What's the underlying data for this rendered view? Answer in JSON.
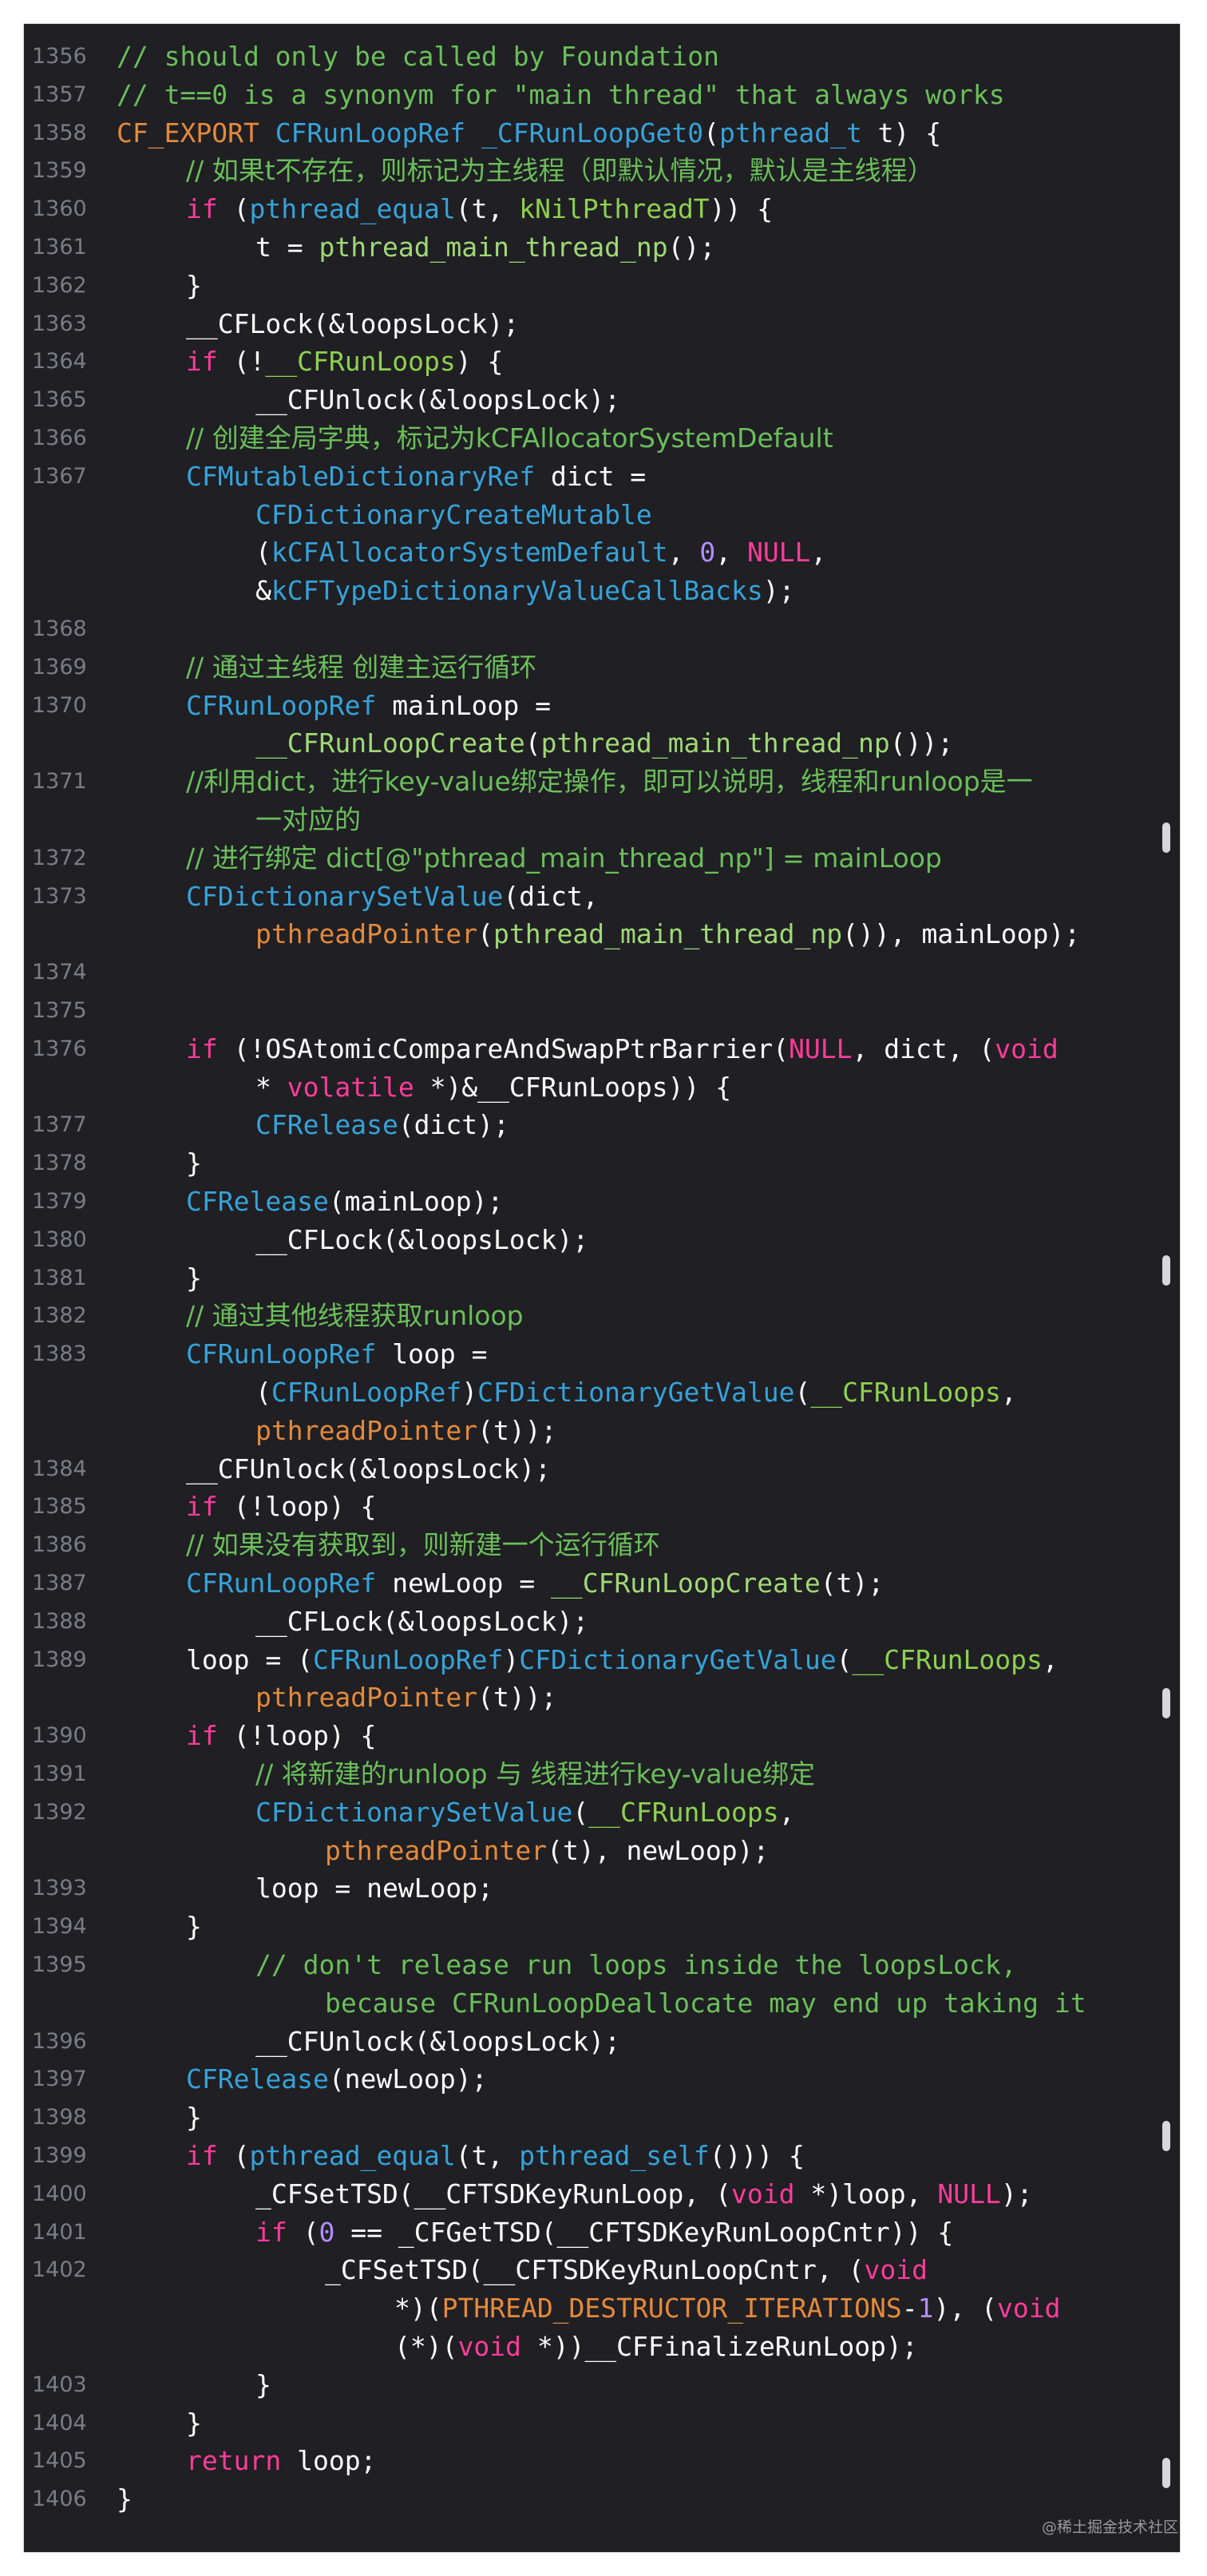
{
  "watermark": "@稀土掘金技术社区",
  "lines": [
    {
      "ln": "1356",
      "segs": [
        {
          "t": "// should only be called by Foundation",
          "c": "comment"
        }
      ]
    },
    {
      "ln": "1357",
      "segs": [
        {
          "t": "// t==0 is a synonym for \"main thread\" that always works",
          "c": "comment"
        }
      ]
    },
    {
      "ln": "1358",
      "segs": [
        {
          "t": "CF_EXPORT ",
          "c": "orange"
        },
        {
          "t": "CFRunLoopRef ",
          "c": "blue"
        },
        {
          "t": "_CFRunLoopGet0",
          "c": "blue"
        },
        {
          "t": "(",
          "c": "plain"
        },
        {
          "t": "pthread_t",
          "c": "blue"
        },
        {
          "t": " t) {",
          "c": "plain"
        }
      ]
    },
    {
      "ln": "1359",
      "ind": 1,
      "segs": [
        {
          "t": "// 如果t不存在，则标记为主线程（即默认情况，默认是主线程）",
          "c": "comment cjk"
        }
      ]
    },
    {
      "ln": "1360",
      "ind": 1,
      "segs": [
        {
          "t": "if",
          "c": "magenta"
        },
        {
          "t": " (",
          "c": "plain"
        },
        {
          "t": "pthread_equal",
          "c": "blue"
        },
        {
          "t": "(t, ",
          "c": "plain"
        },
        {
          "t": "kNilPthreadT",
          "c": "lgreen"
        },
        {
          "t": ")) {",
          "c": "plain"
        }
      ]
    },
    {
      "ln": "1361",
      "ind": 2,
      "segs": [
        {
          "t": "t = ",
          "c": "plain"
        },
        {
          "t": "pthread_main_thread_np",
          "c": "green"
        },
        {
          "t": "();",
          "c": "plain"
        }
      ]
    },
    {
      "ln": "1362",
      "ind": 1,
      "segs": [
        {
          "t": "}",
          "c": "plain"
        }
      ]
    },
    {
      "ln": "1363",
      "ind": 1,
      "segs": [
        {
          "t": "__CFLock(&loopsLock);",
          "c": "plain"
        }
      ]
    },
    {
      "ln": "1364",
      "ind": 1,
      "segs": [
        {
          "t": "if",
          "c": "magenta"
        },
        {
          "t": " (!",
          "c": "plain"
        },
        {
          "t": "__CFRunLoops",
          "c": "lgreen"
        },
        {
          "t": ") {",
          "c": "plain"
        }
      ]
    },
    {
      "ln": "1365",
      "ind": 2,
      "segs": [
        {
          "t": "__CFUnlock(&loopsLock);",
          "c": "plain"
        }
      ]
    },
    {
      "ln": "1366",
      "ind": 1,
      "segs": [
        {
          "t": "// 创建全局字典，标记为kCFAllocatorSystemDefault",
          "c": "comment cjk"
        }
      ]
    },
    {
      "ln": "1367",
      "ind": 1,
      "segs": [
        {
          "t": "CFMutableDictionaryRef",
          "c": "blue"
        },
        {
          "t": " dict =",
          "c": "plain"
        }
      ]
    },
    {
      "ln": "",
      "ind": 2,
      "segs": [
        {
          "t": "CFDictionaryCreateMutable",
          "c": "blue"
        }
      ]
    },
    {
      "ln": "",
      "ind": 2,
      "segs": [
        {
          "t": "(",
          "c": "plain"
        },
        {
          "t": "kCFAllocatorSystemDefault",
          "c": "blue"
        },
        {
          "t": ", ",
          "c": "plain"
        },
        {
          "t": "0",
          "c": "purple"
        },
        {
          "t": ", ",
          "c": "plain"
        },
        {
          "t": "NULL",
          "c": "magenta"
        },
        {
          "t": ",",
          "c": "plain"
        }
      ]
    },
    {
      "ln": "",
      "ind": 2,
      "segs": [
        {
          "t": "&",
          "c": "plain"
        },
        {
          "t": "kCFTypeDictionaryValueCallBacks",
          "c": "blue"
        },
        {
          "t": ");",
          "c": "plain"
        }
      ]
    },
    {
      "ln": "1368",
      "segs": []
    },
    {
      "ln": "1369",
      "ind": 1,
      "segs": [
        {
          "t": "// 通过主线程 创建主运行循环",
          "c": "comment cjk"
        }
      ]
    },
    {
      "ln": "1370",
      "ind": 1,
      "segs": [
        {
          "t": "CFRunLoopRef",
          "c": "blue"
        },
        {
          "t": " mainLoop =",
          "c": "plain"
        }
      ]
    },
    {
      "ln": "",
      "ind": 2,
      "segs": [
        {
          "t": "__CFRunLoopCreate",
          "c": "green"
        },
        {
          "t": "(",
          "c": "plain"
        },
        {
          "t": "pthread_main_thread_np",
          "c": "green"
        },
        {
          "t": "());",
          "c": "plain"
        }
      ]
    },
    {
      "ln": "1371",
      "ind": 1,
      "segs": [
        {
          "t": "//利用dict，进行key-value绑定操作，即可以说明，线程和runloop是一",
          "c": "comment cjk"
        }
      ]
    },
    {
      "ln": "",
      "ind": 2,
      "segs": [
        {
          "t": "一对应的",
          "c": "comment cjk"
        }
      ]
    },
    {
      "ln": "1372",
      "ind": 1,
      "segs": [
        {
          "t": "// 进行绑定 dict[@\"pthread_main_thread_np\"] = mainLoop",
          "c": "comment cjk"
        }
      ]
    },
    {
      "ln": "1373",
      "ind": 1,
      "segs": [
        {
          "t": "CFDictionarySetValue",
          "c": "blue"
        },
        {
          "t": "(dict,",
          "c": "plain"
        }
      ]
    },
    {
      "ln": "",
      "ind": 2,
      "segs": [
        {
          "t": "pthreadPointer",
          "c": "orange"
        },
        {
          "t": "(",
          "c": "plain"
        },
        {
          "t": "pthread_main_thread_np",
          "c": "green"
        },
        {
          "t": "()), mainLoop);",
          "c": "plain"
        }
      ]
    },
    {
      "ln": "1374",
      "segs": []
    },
    {
      "ln": "1375",
      "segs": []
    },
    {
      "ln": "1376",
      "ind": 1,
      "segs": [
        {
          "t": "if",
          "c": "magenta"
        },
        {
          "t": " (!OSAtomicCompareAndSwapPtrBarrier(",
          "c": "plain"
        },
        {
          "t": "NULL",
          "c": "magenta"
        },
        {
          "t": ", dict, (",
          "c": "plain"
        },
        {
          "t": "void",
          "c": "magenta"
        }
      ]
    },
    {
      "ln": "",
      "ind": 2,
      "segs": [
        {
          "t": "* ",
          "c": "plain"
        },
        {
          "t": "volatile",
          "c": "magenta"
        },
        {
          "t": " *)&__CFRunLoops)) {",
          "c": "plain"
        }
      ]
    },
    {
      "ln": "1377",
      "ind": 2,
      "segs": [
        {
          "t": "CFRelease",
          "c": "blue"
        },
        {
          "t": "(dict);",
          "c": "plain"
        }
      ]
    },
    {
      "ln": "1378",
      "ind": 1,
      "segs": [
        {
          "t": "}",
          "c": "plain"
        }
      ]
    },
    {
      "ln": "1379",
      "ind": 1,
      "segs": [
        {
          "t": "CFRelease",
          "c": "blue"
        },
        {
          "t": "(mainLoop);",
          "c": "plain"
        }
      ]
    },
    {
      "ln": "1380",
      "ind": 2,
      "segs": [
        {
          "t": "__CFLock(&loopsLock);",
          "c": "plain"
        }
      ]
    },
    {
      "ln": "1381",
      "ind": 1,
      "segs": [
        {
          "t": "}",
          "c": "plain"
        }
      ]
    },
    {
      "ln": "1382",
      "ind": 1,
      "segs": [
        {
          "t": "// 通过其他线程获取runloop",
          "c": "comment cjk"
        }
      ]
    },
    {
      "ln": "1383",
      "ind": 1,
      "segs": [
        {
          "t": "CFRunLoopRef",
          "c": "blue"
        },
        {
          "t": " loop =",
          "c": "plain"
        }
      ]
    },
    {
      "ln": "",
      "ind": 2,
      "segs": [
        {
          "t": "(",
          "c": "plain"
        },
        {
          "t": "CFRunLoopRef",
          "c": "blue"
        },
        {
          "t": ")",
          "c": "plain"
        },
        {
          "t": "CFDictionaryGetValue",
          "c": "blue"
        },
        {
          "t": "(",
          "c": "plain"
        },
        {
          "t": "__CFRunLoops",
          "c": "lgreen"
        },
        {
          "t": ",",
          "c": "plain"
        }
      ]
    },
    {
      "ln": "",
      "ind": 2,
      "segs": [
        {
          "t": "pthreadPointer",
          "c": "orange"
        },
        {
          "t": "(t));",
          "c": "plain"
        }
      ]
    },
    {
      "ln": "1384",
      "ind": 1,
      "segs": [
        {
          "t": "__CFUnlock(&loopsLock);",
          "c": "plain"
        }
      ]
    },
    {
      "ln": "1385",
      "ind": 1,
      "segs": [
        {
          "t": "if",
          "c": "magenta"
        },
        {
          "t": " (!loop) {",
          "c": "plain"
        }
      ]
    },
    {
      "ln": "1386",
      "ind": 1,
      "segs": [
        {
          "t": "// 如果没有获取到，则新建一个运行循环",
          "c": "comment cjk"
        }
      ]
    },
    {
      "ln": "1387",
      "ind": 1,
      "segs": [
        {
          "t": "CFRunLoopRef",
          "c": "blue"
        },
        {
          "t": " newLoop = ",
          "c": "plain"
        },
        {
          "t": "__CFRunLoopCreate",
          "c": "green"
        },
        {
          "t": "(t);",
          "c": "plain"
        }
      ]
    },
    {
      "ln": "1388",
      "ind": 2,
      "segs": [
        {
          "t": "__CFLock(&loopsLock);",
          "c": "plain"
        }
      ]
    },
    {
      "ln": "1389",
      "ind": 1,
      "segs": [
        {
          "t": "loop = (",
          "c": "plain"
        },
        {
          "t": "CFRunLoopRef",
          "c": "blue"
        },
        {
          "t": ")",
          "c": "plain"
        },
        {
          "t": "CFDictionaryGetValue",
          "c": "blue"
        },
        {
          "t": "(",
          "c": "plain"
        },
        {
          "t": "__CFRunLoops",
          "c": "lgreen"
        },
        {
          "t": ",",
          "c": "plain"
        }
      ]
    },
    {
      "ln": "",
      "ind": 2,
      "segs": [
        {
          "t": "pthreadPointer",
          "c": "orange"
        },
        {
          "t": "(t));",
          "c": "plain"
        }
      ]
    },
    {
      "ln": "1390",
      "ind": 1,
      "segs": [
        {
          "t": "if",
          "c": "magenta"
        },
        {
          "t": " (!loop) {",
          "c": "plain"
        }
      ]
    },
    {
      "ln": "1391",
      "ind": 2,
      "segs": [
        {
          "t": "// 将新建的runloop 与 线程进行key-value绑定",
          "c": "comment cjk"
        }
      ]
    },
    {
      "ln": "1392",
      "ind": 2,
      "segs": [
        {
          "t": "CFDictionarySetValue",
          "c": "blue"
        },
        {
          "t": "(",
          "c": "plain"
        },
        {
          "t": "__CFRunLoops",
          "c": "lgreen"
        },
        {
          "t": ",",
          "c": "plain"
        }
      ]
    },
    {
      "ln": "",
      "ind": 3,
      "segs": [
        {
          "t": "pthreadPointer",
          "c": "orange"
        },
        {
          "t": "(t), newLoop);",
          "c": "plain"
        }
      ]
    },
    {
      "ln": "1393",
      "ind": 2,
      "segs": [
        {
          "t": "loop = newLoop;",
          "c": "plain"
        }
      ]
    },
    {
      "ln": "1394",
      "ind": 1,
      "segs": [
        {
          "t": "}",
          "c": "plain"
        }
      ]
    },
    {
      "ln": "1395",
      "ind": 2,
      "segs": [
        {
          "t": "// don't release run loops inside the loopsLock,",
          "c": "comment"
        }
      ]
    },
    {
      "ln": "",
      "ind": 3,
      "segs": [
        {
          "t": "because CFRunLoopDeallocate may end up taking it",
          "c": "comment"
        }
      ]
    },
    {
      "ln": "1396",
      "ind": 2,
      "segs": [
        {
          "t": "__CFUnlock(&loopsLock);",
          "c": "plain"
        }
      ]
    },
    {
      "ln": "1397",
      "ind": 1,
      "segs": [
        {
          "t": "CFRelease",
          "c": "blue"
        },
        {
          "t": "(newLoop);",
          "c": "plain"
        }
      ]
    },
    {
      "ln": "1398",
      "ind": 1,
      "segs": [
        {
          "t": "}",
          "c": "plain"
        }
      ]
    },
    {
      "ln": "1399",
      "ind": 1,
      "segs": [
        {
          "t": "if",
          "c": "magenta"
        },
        {
          "t": " (",
          "c": "plain"
        },
        {
          "t": "pthread_equal",
          "c": "blue"
        },
        {
          "t": "(t, ",
          "c": "plain"
        },
        {
          "t": "pthread_self",
          "c": "blue"
        },
        {
          "t": "())) {",
          "c": "plain"
        }
      ]
    },
    {
      "ln": "1400",
      "ind": 2,
      "segs": [
        {
          "t": "_CFSetTSD(__CFTSDKeyRunLoop, (",
          "c": "plain"
        },
        {
          "t": "void",
          "c": "magenta"
        },
        {
          "t": " *)loop, ",
          "c": "plain"
        },
        {
          "t": "NULL",
          "c": "magenta"
        },
        {
          "t": ");",
          "c": "plain"
        }
      ]
    },
    {
      "ln": "1401",
      "ind": 2,
      "segs": [
        {
          "t": "if",
          "c": "magenta"
        },
        {
          "t": " (",
          "c": "plain"
        },
        {
          "t": "0",
          "c": "purple"
        },
        {
          "t": " == _CFGetTSD(__CFTSDKeyRunLoopCntr)) {",
          "c": "plain"
        }
      ]
    },
    {
      "ln": "1402",
      "ind": 3,
      "segs": [
        {
          "t": "_CFSetTSD(__CFTSDKeyRunLoopCntr, (",
          "c": "plain"
        },
        {
          "t": "void",
          "c": "magenta"
        }
      ]
    },
    {
      "ln": "",
      "ind": 4,
      "segs": [
        {
          "t": "*)(",
          "c": "plain"
        },
        {
          "t": "PTHREAD_DESTRUCTOR_ITERATIONS",
          "c": "orange"
        },
        {
          "t": "-",
          "c": "plain"
        },
        {
          "t": "1",
          "c": "purple"
        },
        {
          "t": "), (",
          "c": "plain"
        },
        {
          "t": "void",
          "c": "magenta"
        }
      ]
    },
    {
      "ln": "",
      "ind": 4,
      "segs": [
        {
          "t": "(*)(",
          "c": "plain"
        },
        {
          "t": "void",
          "c": "magenta"
        },
        {
          "t": " *))__CFFinalizeRunLoop);",
          "c": "plain"
        }
      ]
    },
    {
      "ln": "1403",
      "ind": 2,
      "segs": [
        {
          "t": "}",
          "c": "plain"
        }
      ]
    },
    {
      "ln": "1404",
      "ind": 1,
      "segs": [
        {
          "t": "}",
          "c": "plain"
        }
      ]
    },
    {
      "ln": "1405",
      "ind": 1,
      "segs": [
        {
          "t": "return",
          "c": "magenta"
        },
        {
          "t": " loop;",
          "c": "plain"
        }
      ]
    },
    {
      "ln": "1406",
      "segs": [
        {
          "t": "}",
          "c": "plain"
        }
      ]
    }
  ]
}
